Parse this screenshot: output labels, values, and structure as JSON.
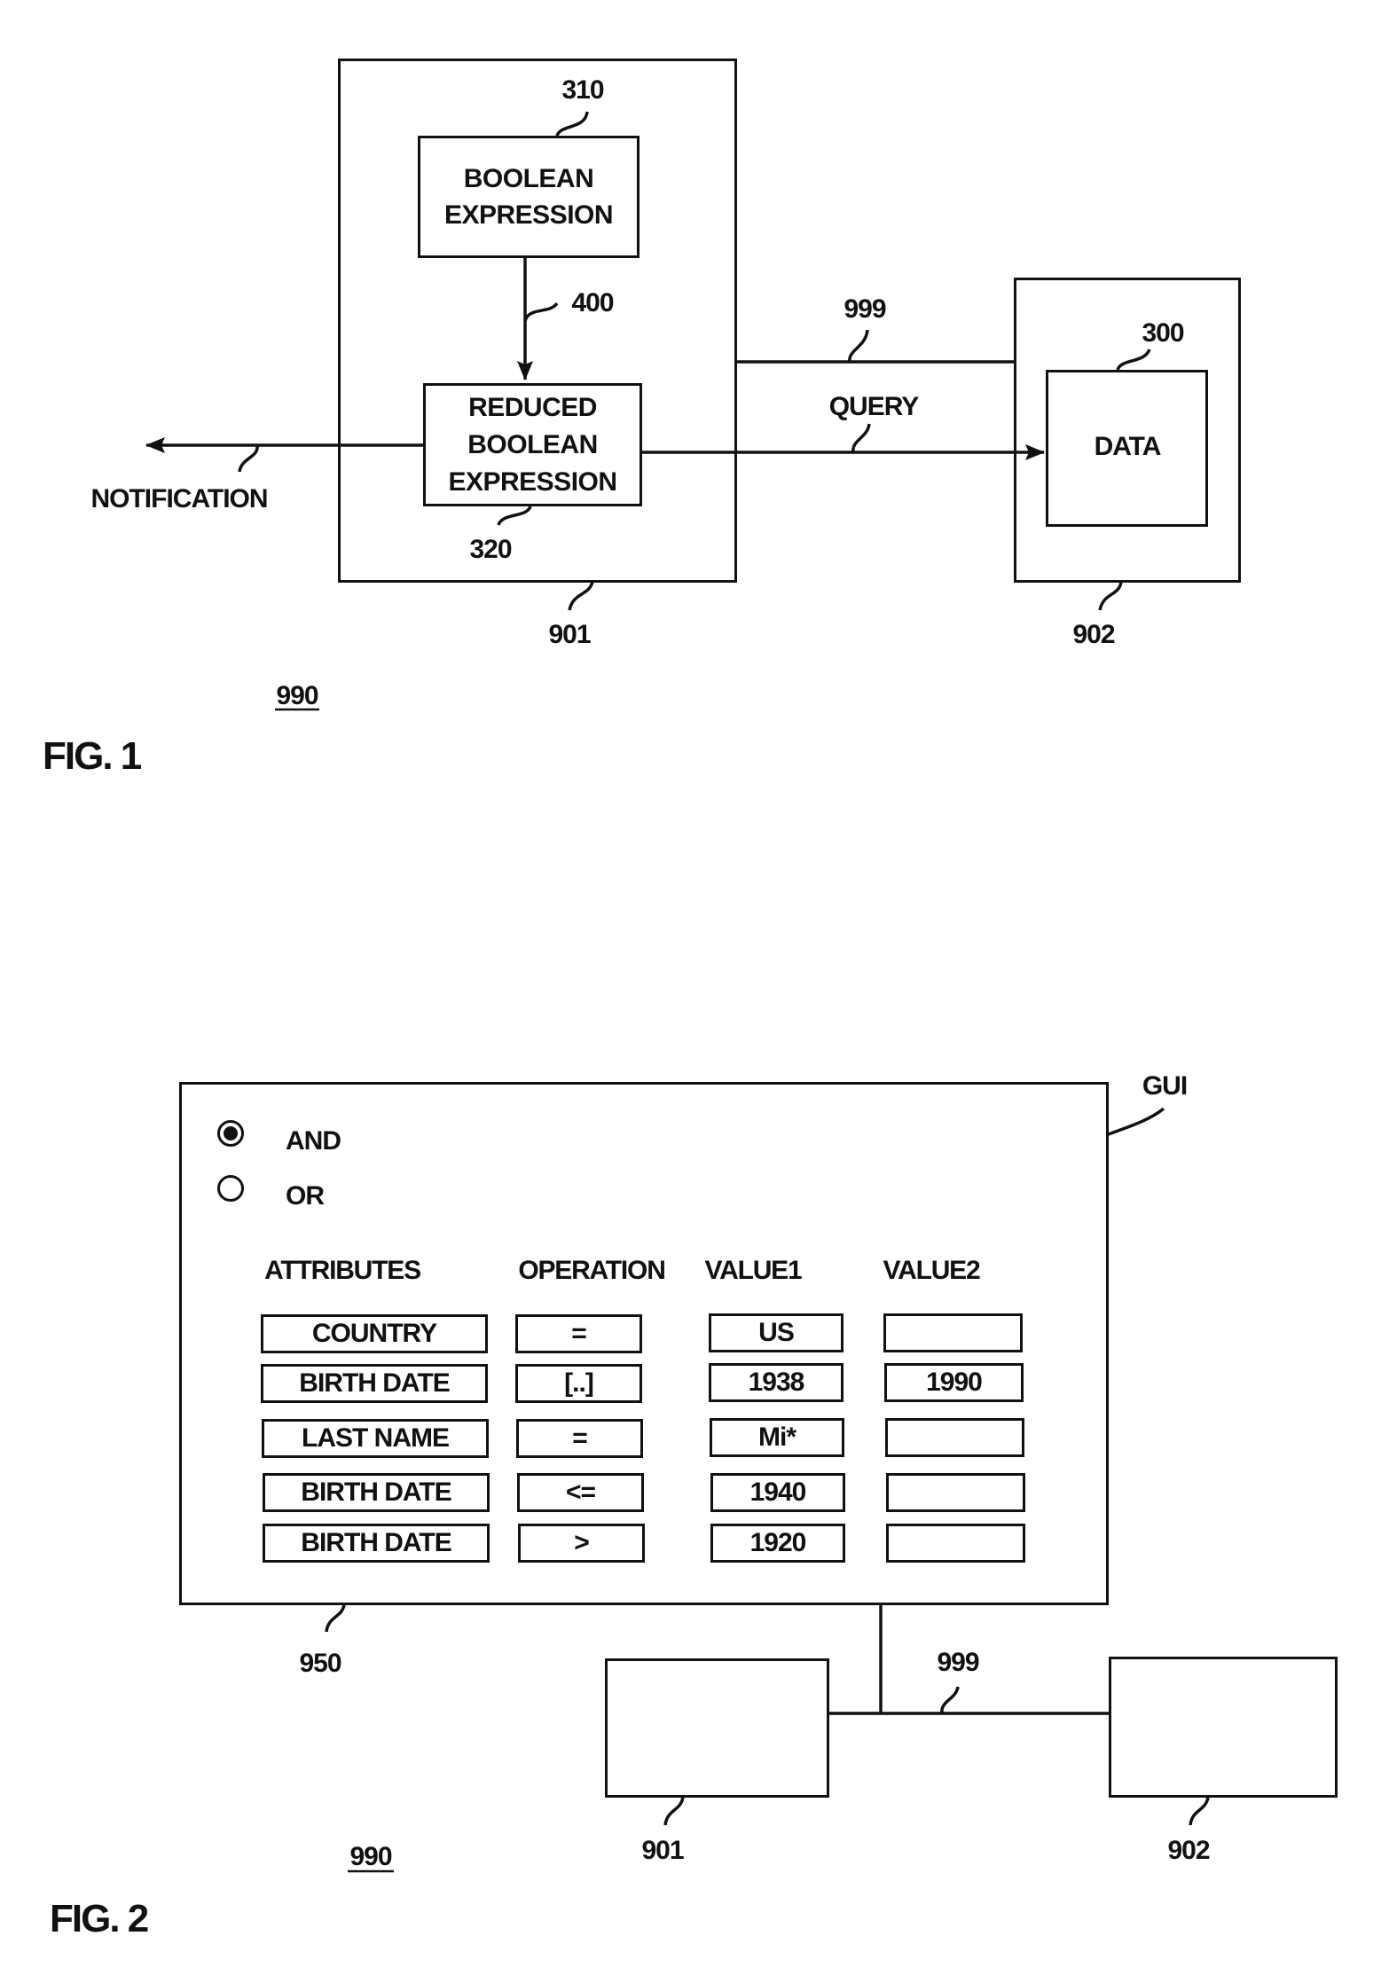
{
  "figure1": {
    "caption": "FIG. 1",
    "system_ref": "990",
    "node_901": {
      "ref": "901"
    },
    "boolean_expression": {
      "ref": "310",
      "line1": "BOOLEAN",
      "line2": "EXPRESSION"
    },
    "reduction_arrow": {
      "ref": "400"
    },
    "reduced_expression": {
      "ref": "320",
      "line1": "REDUCED",
      "line2": "BOOLEAN",
      "line3": "EXPRESSION"
    },
    "notification_label": "NOTIFICATION",
    "network": {
      "ref": "999"
    },
    "query_label": "QUERY",
    "node_902": {
      "ref": "902"
    },
    "data_store": {
      "ref": "300",
      "label": "DATA"
    }
  },
  "figure2": {
    "caption": "FIG. 2",
    "system_ref": "990",
    "gui": {
      "ref": "950",
      "label": "GUI",
      "combinators": [
        {
          "label": "AND",
          "selected": true
        },
        {
          "label": "OR",
          "selected": false
        }
      ],
      "columns": [
        "ATTRIBUTES",
        "OPERATION",
        "VALUE1",
        "VALUE2"
      ],
      "rows": [
        {
          "attribute": "COUNTRY",
          "operation": "=",
          "value1": "US",
          "value2": ""
        },
        {
          "attribute": "BIRTH DATE",
          "operation": "[..]",
          "value1": "1938",
          "value2": "1990"
        },
        {
          "attribute": "LAST NAME",
          "operation": "=",
          "value1": "Mi*",
          "value2": ""
        },
        {
          "attribute": "BIRTH DATE",
          "operation": "<=",
          "value1": "1940",
          "value2": ""
        },
        {
          "attribute": "BIRTH DATE",
          "operation": ">",
          "value1": "1920",
          "value2": ""
        }
      ]
    },
    "node_901": {
      "ref": "901"
    },
    "node_902": {
      "ref": "902"
    },
    "network": {
      "ref": "999"
    }
  }
}
